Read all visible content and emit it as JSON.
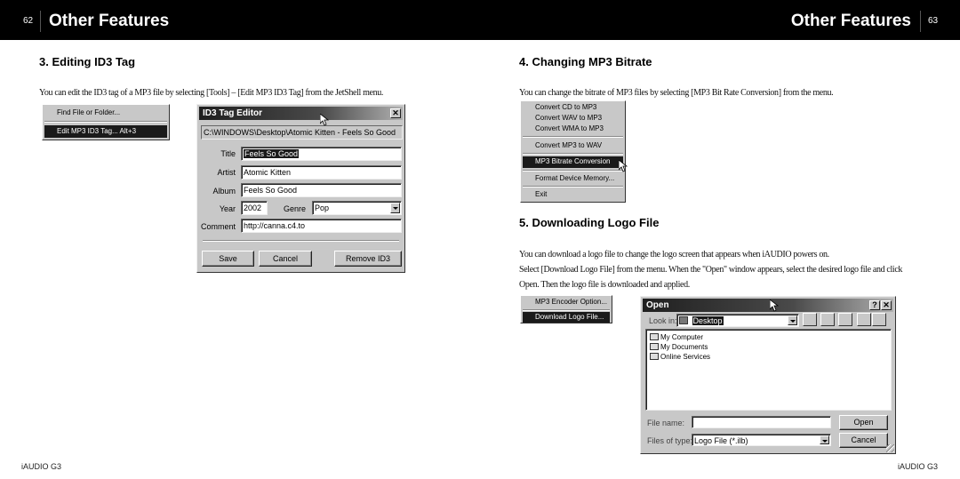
{
  "header": {
    "left_page_number": "62",
    "right_page_number": "63",
    "left_title": "Other Features",
    "right_title": "Other Features"
  },
  "section3": {
    "title": "3. Editing ID3 Tag",
    "body": "You can edit the ID3 tag of a MP3 file by selecting [Tools] – [Edit MP3 ID3 Tag] from the JetShell menu.",
    "menu": {
      "items": [
        {
          "label": "Find File or Folder...",
          "selected": false
        },
        {
          "label": "Edit MP3 ID3 Tag...   Alt+3",
          "selected": true
        }
      ]
    },
    "dialog": {
      "title": "ID3 Tag Editor",
      "close_glyph": "✕",
      "path": "C:\\WINDOWS\\Desktop\\Atomic Kitten - Feels So Good",
      "fields": {
        "title_label": "Title",
        "title_value": "Feels So Good",
        "artist_label": "Artist",
        "artist_value": "Atomic Kitten",
        "album_label": "Album",
        "album_value": "Feels So Good",
        "year_label": "Year",
        "year_value": "2002",
        "genre_label": "Genre",
        "genre_value": "Pop",
        "comment_label": "Comment",
        "comment_value": "http://canna.c4.to"
      },
      "buttons": {
        "save": "Save",
        "cancel": "Cancel",
        "remove": "Remove ID3"
      }
    }
  },
  "section4": {
    "title": "4. Changing MP3 Bitrate",
    "body": "You can change the bitrate of MP3 files by selecting [MP3 Bit Rate Conversion] from the menu.",
    "menu": {
      "items": [
        {
          "label": "Convert CD to MP3",
          "selected": false
        },
        {
          "label": "Convert WAV to MP3",
          "selected": false
        },
        {
          "label": "Convert WMA to MP3",
          "selected": false
        },
        {
          "label": "Convert MP3 to WAV",
          "selected": false
        },
        {
          "label": "MP3 Bitrate Conversion",
          "selected": true
        },
        {
          "label": "Format Device Memory...",
          "selected": false
        },
        {
          "label": "Exit",
          "selected": false
        }
      ]
    }
  },
  "section5": {
    "title": "5. Downloading Logo File",
    "body_lines": [
      "You can download a logo file to change the logo screen that appears when iAUDIO powers on.",
      "Select [Download Logo File] from the menu. When the \"Open\" window appears, select the desired logo file and click",
      "Open. Then the logo file is downloaded and applied."
    ],
    "menu": {
      "items": [
        {
          "label": "MP3 Encoder Option...",
          "selected": false
        },
        {
          "label": "Download Logo File...",
          "selected": true
        }
      ]
    },
    "open_dialog": {
      "title": "Open",
      "help_glyph": "?",
      "close_glyph": "✕",
      "look_in_label": "Look in:",
      "look_in_value": "Desktop",
      "list_items": [
        "My Computer",
        "My Documents",
        "Online Services"
      ],
      "file_name_label": "File name:",
      "file_name_value": "",
      "files_of_type_label": "Files of type:",
      "files_of_type_value": "Logo File (*.ilb)",
      "open_button": "Open",
      "cancel_button": "Cancel"
    }
  },
  "footer": {
    "left": "iAUDIO G3",
    "right": "iAUDIO G3"
  }
}
